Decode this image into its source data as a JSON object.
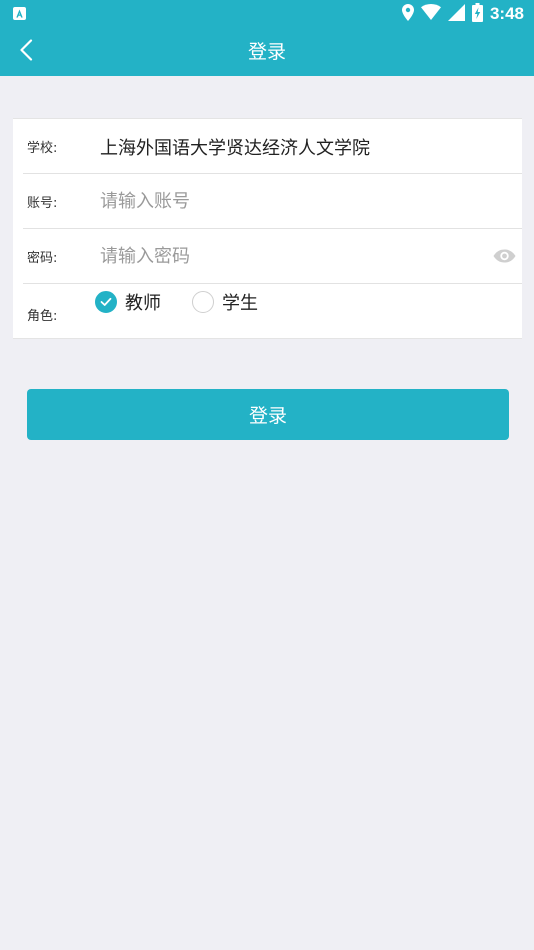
{
  "status_bar": {
    "time": "3:48",
    "icons": [
      "notification-a-icon",
      "location-icon",
      "wifi-icon",
      "signal-icon",
      "battery-charging-icon"
    ]
  },
  "app_bar": {
    "title": "登录",
    "back_icon": "chevron-left-icon"
  },
  "form": {
    "school": {
      "label": "学校:",
      "value": "上海外国语大学贤达经济人文学院"
    },
    "account": {
      "label": "账号:",
      "value": "",
      "placeholder": "请输入账号"
    },
    "password": {
      "label": "密码:",
      "value": "",
      "placeholder": "请输入密码",
      "toggle_icon": "eye-icon"
    },
    "role": {
      "label": "角色:",
      "options": [
        {
          "label": "教师",
          "selected": true
        },
        {
          "label": "学生",
          "selected": false
        }
      ]
    }
  },
  "login_button": {
    "label": "登录"
  },
  "colors": {
    "primary": "#23b2c6",
    "background": "#efeff4",
    "placeholder": "#9a9a9a"
  }
}
